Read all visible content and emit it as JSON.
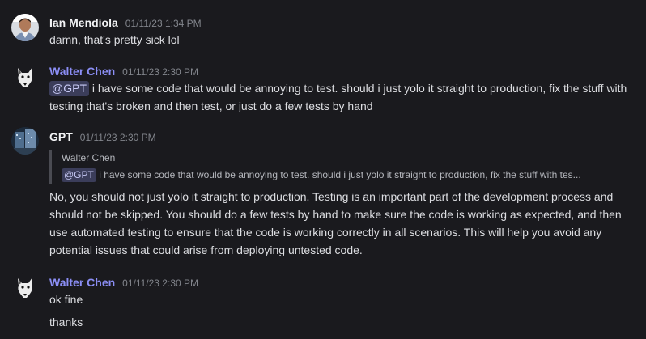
{
  "messages": [
    {
      "author": "Ian Mendiola",
      "time": "01/11/23 1:34 PM",
      "lines": [
        "damn, that's pretty sick lol"
      ]
    },
    {
      "author": "Walter Chen",
      "time": "01/11/23 2:30 PM",
      "mention": "@GPT",
      "body": "i have some code that would be annoying to test. should i just yolo it straight to production, fix the stuff with testing that's broken and then test, or just do a few tests by hand"
    },
    {
      "author": "GPT",
      "time": "01/11/23 2:30 PM",
      "reply": {
        "author": "Walter Chen",
        "mention": "@GPT",
        "body": "i have some code that would be annoying to test. should i just yolo it straight to production, fix the stuff with tes..."
      },
      "body": "No, you should not just yolo it straight to production. Testing is an important part of the development process and should not be skipped. You should do a few tests by hand to make sure the code is working as expected, and then use automated testing to ensure that the code is working correctly in all scenarios. This will help you avoid any potential issues that could arise from deploying untested code."
    },
    {
      "author": "Walter Chen",
      "time": "01/11/23 2:30 PM",
      "lines": [
        "ok fine",
        "thanks"
      ]
    }
  ],
  "colors": {
    "background": "#1a1a1e",
    "accent_name": "#8b8ef5",
    "mention_bg": "#3b3d5a"
  },
  "icons": [
    "user-avatar",
    "dog-avatar",
    "gpt-avatar"
  ]
}
